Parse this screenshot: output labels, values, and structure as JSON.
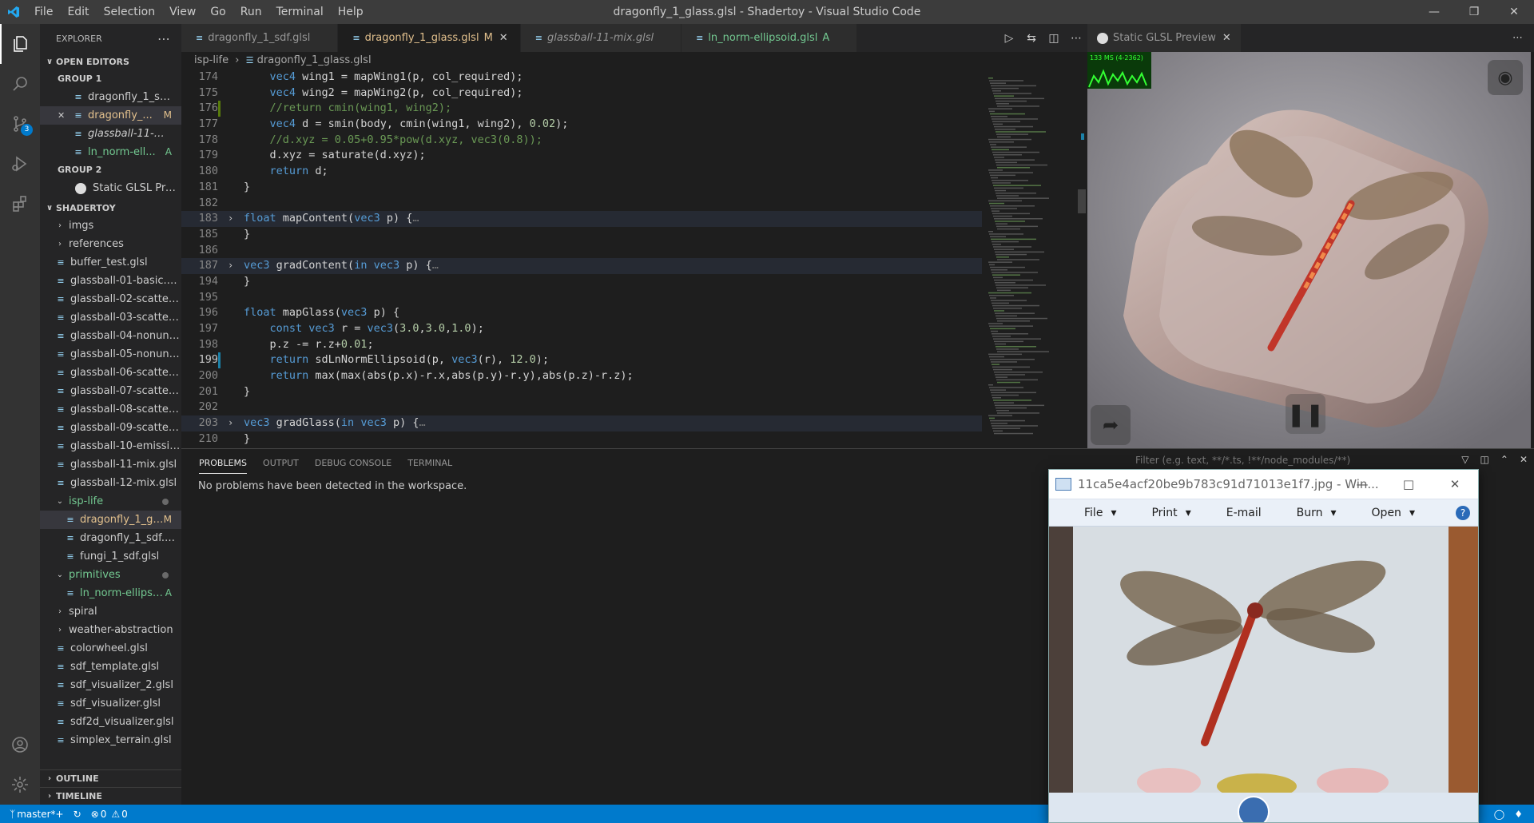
{
  "titlebar": {
    "menus": [
      "File",
      "Edit",
      "Selection",
      "View",
      "Go",
      "Run",
      "Terminal",
      "Help"
    ],
    "title": "dragonfly_1_glass.glsl - Shadertoy - Visual Studio Code"
  },
  "activity": {
    "scm_badge": "3"
  },
  "sidebar": {
    "header": "EXPLORER",
    "open_editors": "OPEN EDITORS",
    "group1": "GROUP 1",
    "group1_items": [
      {
        "name": "dragonfly_1_sdf....",
        "mark": "",
        "close": ""
      },
      {
        "name": "dragonfly_...",
        "mark": "M",
        "close": "✕"
      },
      {
        "name": "glassball-11-mix....",
        "mark": "",
        "close": ""
      },
      {
        "name": "ln_norm-ell...",
        "mark": "A",
        "close": ""
      }
    ],
    "group2": "GROUP 2",
    "group2_items": [
      {
        "name": "Static GLSL Previ..."
      }
    ],
    "shadertoy": "SHADERTOY",
    "tree": [
      {
        "name": "imgs",
        "type": "folder"
      },
      {
        "name": "references",
        "type": "folder"
      },
      {
        "name": "buffer_test.glsl",
        "type": "file"
      },
      {
        "name": "glassball-01-basic.glsl",
        "type": "file"
      },
      {
        "name": "glassball-02-scatter....",
        "type": "file"
      },
      {
        "name": "glassball-03-scatter....",
        "type": "file"
      },
      {
        "name": "glassball-04-nonunif...",
        "type": "file"
      },
      {
        "name": "glassball-05-nonunif...",
        "type": "file"
      },
      {
        "name": "glassball-06-scatter_...",
        "type": "file"
      },
      {
        "name": "glassball-07-scatter....",
        "type": "file"
      },
      {
        "name": "glassball-08-scatter....",
        "type": "file"
      },
      {
        "name": "glassball-09-scatter....",
        "type": "file"
      },
      {
        "name": "glassball-10-emissio...",
        "type": "file"
      },
      {
        "name": "glassball-11-mix.glsl",
        "type": "file"
      },
      {
        "name": "glassball-12-mix.glsl",
        "type": "file"
      },
      {
        "name": "isp-life",
        "type": "open-folder"
      },
      {
        "name": "dragonfly_1_gl...",
        "type": "sub",
        "mark": "M",
        "selected": true
      },
      {
        "name": "dragonfly_1_sdf.glsl",
        "type": "sub"
      },
      {
        "name": "fungi_1_sdf.glsl",
        "type": "sub"
      },
      {
        "name": "primitives",
        "type": "open-folder"
      },
      {
        "name": "ln_norm-ellipso...",
        "type": "sub",
        "mark": "A"
      },
      {
        "name": "spiral",
        "type": "folder"
      },
      {
        "name": "weather-abstraction",
        "type": "folder"
      },
      {
        "name": "colorwheel.glsl",
        "type": "file"
      },
      {
        "name": "sdf_template.glsl",
        "type": "file"
      },
      {
        "name": "sdf_visualizer_2.glsl",
        "type": "file"
      },
      {
        "name": "sdf_visualizer.glsl",
        "type": "file"
      },
      {
        "name": "sdf2d_visualizer.glsl",
        "type": "file"
      },
      {
        "name": "simplex_terrain.glsl",
        "type": "file"
      }
    ],
    "outline": "OUTLINE",
    "timeline": "TIMELINE"
  },
  "tabs": [
    {
      "label": "dragonfly_1_sdf.glsl",
      "mark": "",
      "active": false,
      "italic": false,
      "color": "#969696"
    },
    {
      "label": "dragonfly_1_glass.glsl",
      "mark": "M",
      "active": true,
      "italic": false,
      "color": "#e2c08d"
    },
    {
      "label": "glassball-11-mix.glsl",
      "mark": "",
      "active": false,
      "italic": true,
      "color": "#969696"
    },
    {
      "label": "ln_norm-ellipsoid.glsl",
      "mark": "A",
      "active": false,
      "italic": false,
      "color": "#73c991"
    }
  ],
  "breadcrumb": {
    "folder": "isp-life",
    "file": "dragonfly_1_glass.glsl"
  },
  "code_lines": [
    {
      "n": "174",
      "t": "    vec4 wing1 = mapWing1(p, col_required);"
    },
    {
      "n": "175",
      "t": "    vec4 wing2 = mapWing2(p, col_required);"
    },
    {
      "n": "176",
      "t": "    //return cmin(wing1, wing2);"
    },
    {
      "n": "177",
      "t": "    vec4 d = smin(body, cmin(wing1, wing2), 0.02);"
    },
    {
      "n": "178",
      "t": "    //d.xyz = 0.05+0.95*pow(d.xyz, vec3(0.8));"
    },
    {
      "n": "179",
      "t": "    d.xyz = saturate(d.xyz);"
    },
    {
      "n": "180",
      "t": "    return d;"
    },
    {
      "n": "181",
      "t": "}"
    },
    {
      "n": "182",
      "t": ""
    },
    {
      "n": "183",
      "t": "float mapContent(vec3 p) {…"
    },
    {
      "n": "185",
      "t": "}"
    },
    {
      "n": "186",
      "t": ""
    },
    {
      "n": "187",
      "t": "vec3 gradContent(in vec3 p) {…"
    },
    {
      "n": "194",
      "t": "}"
    },
    {
      "n": "195",
      "t": ""
    },
    {
      "n": "196",
      "t": "float mapGlass(vec3 p) {"
    },
    {
      "n": "197",
      "t": "    const vec3 r = vec3(3.0,3.0,1.0);"
    },
    {
      "n": "198",
      "t": "    p.z -= r.z+0.01;"
    },
    {
      "n": "199",
      "t": "    return sdLnNormEllipsoid(p, vec3(r), 12.0);"
    },
    {
      "n": "200",
      "t": "    return max(max(abs(p.x)-r.x,abs(p.y)-r.y),abs(p.z)-r.z);"
    },
    {
      "n": "201",
      "t": "}"
    },
    {
      "n": "202",
      "t": ""
    },
    {
      "n": "203",
      "t": "vec3 gradGlass(in vec3 p) {…"
    },
    {
      "n": "210",
      "t": "}"
    }
  ],
  "preview": {
    "tab": "Static GLSL Preview",
    "fps": "133 MS (4-2362)"
  },
  "panel": {
    "tabs": [
      "PROBLEMS",
      "OUTPUT",
      "DEBUG CONSOLE",
      "TERMINAL"
    ],
    "filter_placeholder": "Filter (e.g. text, **/*.ts, !**/node_modules/**)",
    "message": "No problems have been detected in the workspace."
  },
  "photo_viewer": {
    "title": "11ca5e4acf20be9b783c91d71013e1f7.jpg - Win...",
    "menus": [
      "File",
      "Print",
      "E-mail",
      "Burn",
      "Open"
    ]
  },
  "status": {
    "branch": "master*+",
    "errors": "0",
    "warnings": "0"
  },
  "colors": {
    "accent": "#007acc",
    "keyword": "#569cd6",
    "comment": "#6a9955",
    "number": "#b5cea8",
    "modified": "#e2c08d",
    "added": "#73c991"
  }
}
